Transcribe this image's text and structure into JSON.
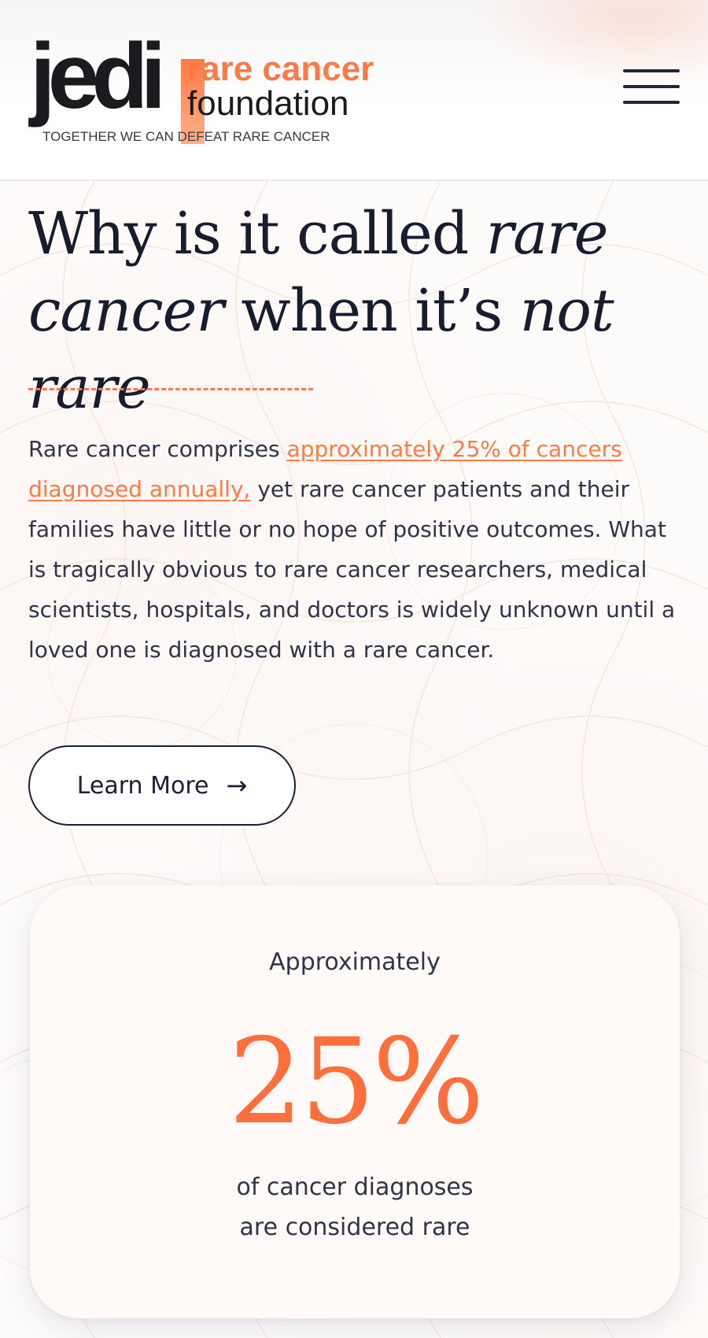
{
  "header": {
    "logo": {
      "mark": "jedi",
      "line1": "rare cancer",
      "line2": "foundation",
      "tagline": "TOGETHER WE CAN DEFEAT RARE CANCER"
    },
    "menu_icon": "hamburger-icon"
  },
  "hero": {
    "headline": {
      "part1": "Why is it called ",
      "part2": "rare cancer",
      "part3": " when it’s ",
      "part4": "not rare"
    },
    "body": {
      "intro": "Rare cancer comprises ",
      "link": "approximately 25% of cancers diagnosed annually,",
      "rest": " yet rare cancer patients and their families have little or no hope of positive outcomes. What is tragically obvious to rare cancer researchers, medical scientists, hospitals, and doctors is widely unknown until a loved one is diagnosed with a rare cancer."
    },
    "cta": {
      "label": "Learn More",
      "icon": "arrow-right-icon",
      "glyph": "→"
    }
  },
  "stat": {
    "pre": "Approximately",
    "value": "25%",
    "post_line1": "of cancer diagnoses",
    "post_line2": "are considered rare"
  },
  "colors": {
    "accent": "#ff7a45",
    "text_dark": "#171c2e",
    "text_body": "#2f3448"
  }
}
